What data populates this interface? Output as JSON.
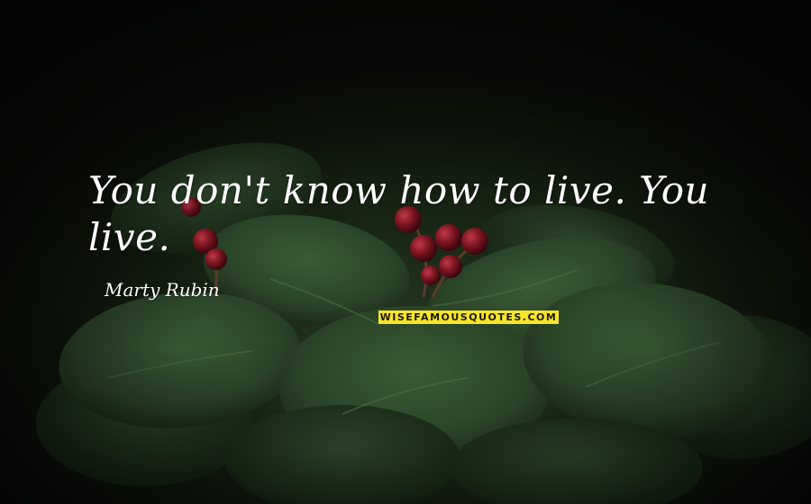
{
  "quote": {
    "text": "You don't know how to live. You live."
  },
  "author": {
    "name": "Marty Rubin"
  },
  "watermark": {
    "text": "WISEFAMOUSQUOTES.COM"
  },
  "colors": {
    "text": "#ffffff",
    "watermark_bg": "#f7e52a",
    "berry": "#7a1420",
    "leaf": "#2c4a2a"
  }
}
